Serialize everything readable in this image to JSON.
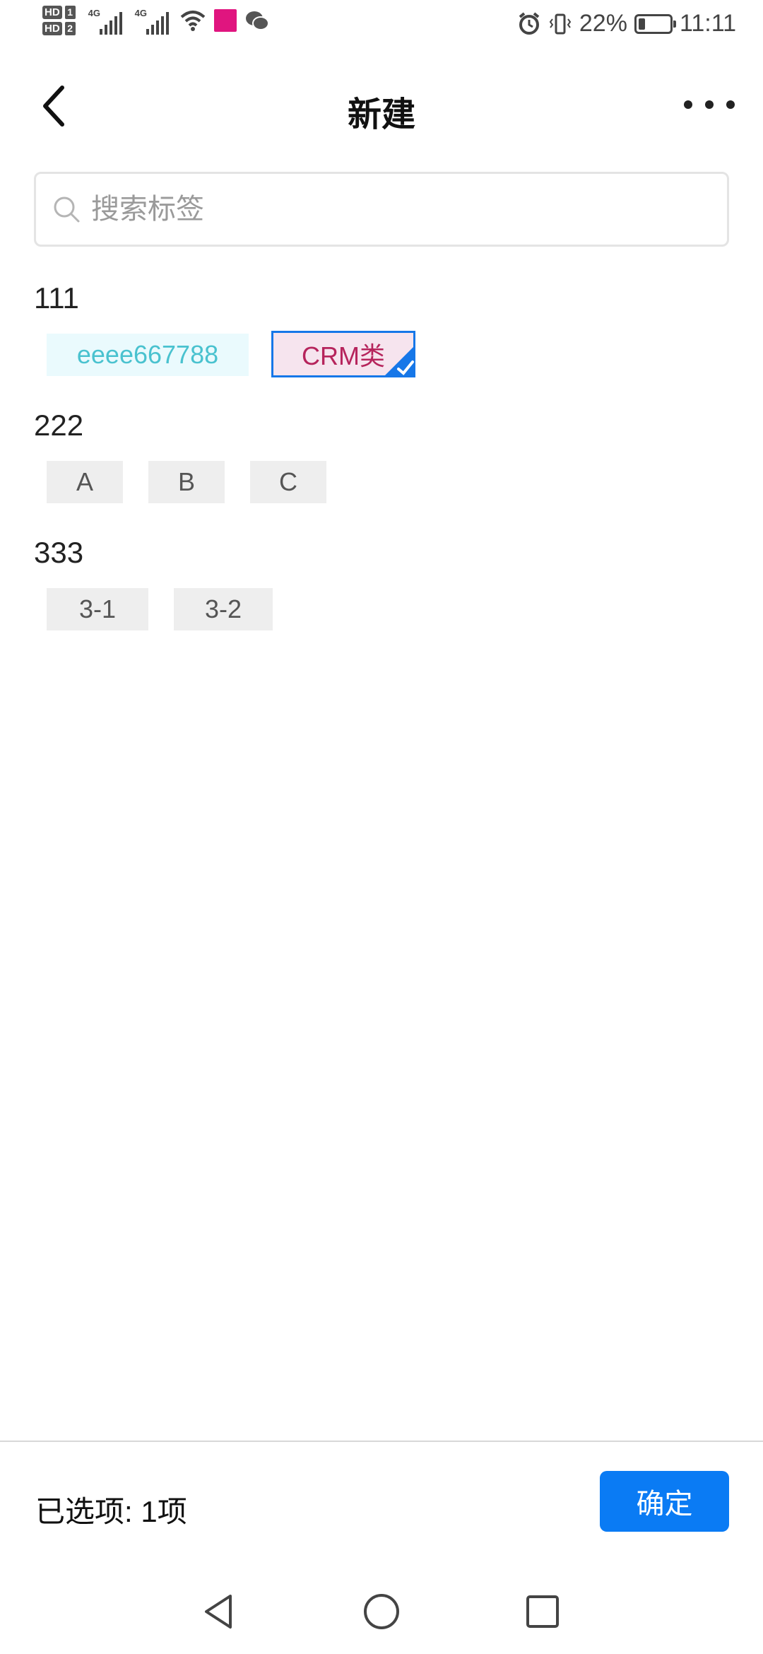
{
  "status_bar": {
    "hd1": "HD",
    "hd1_num": "1",
    "hd2": "HD",
    "hd2_num": "2",
    "network1": "4G",
    "network2": "4G",
    "battery_percent": "22%",
    "battery_level": 0.22,
    "time": "11:11"
  },
  "header": {
    "title": "新建",
    "back_icon": "chevron-left-icon",
    "more_icon": "more-horizontal-icon"
  },
  "search": {
    "placeholder": "搜索标签",
    "value": ""
  },
  "groups": [
    {
      "title": "111",
      "tags": [
        {
          "label": "eeee667788",
          "style": "cyan",
          "selected": false
        },
        {
          "label": "CRM类",
          "style": "magenta",
          "selected": true
        }
      ]
    },
    {
      "title": "222",
      "tags": [
        {
          "label": "A",
          "style": "gray",
          "selected": false
        },
        {
          "label": "B",
          "style": "gray",
          "selected": false
        },
        {
          "label": "C",
          "style": "gray",
          "selected": false
        }
      ]
    },
    {
      "title": "333",
      "tags": [
        {
          "label": "3-1",
          "style": "gray",
          "selected": false
        },
        {
          "label": "3-2",
          "style": "gray",
          "selected": false
        }
      ]
    }
  ],
  "footer": {
    "selected_text": "已选项: 1项",
    "confirm_label": "确定"
  },
  "colors": {
    "accent": "#0a7bf4",
    "selected_border": "#1677e8",
    "selected_text": "#b6245c",
    "cyan_text": "#49c2cf"
  }
}
